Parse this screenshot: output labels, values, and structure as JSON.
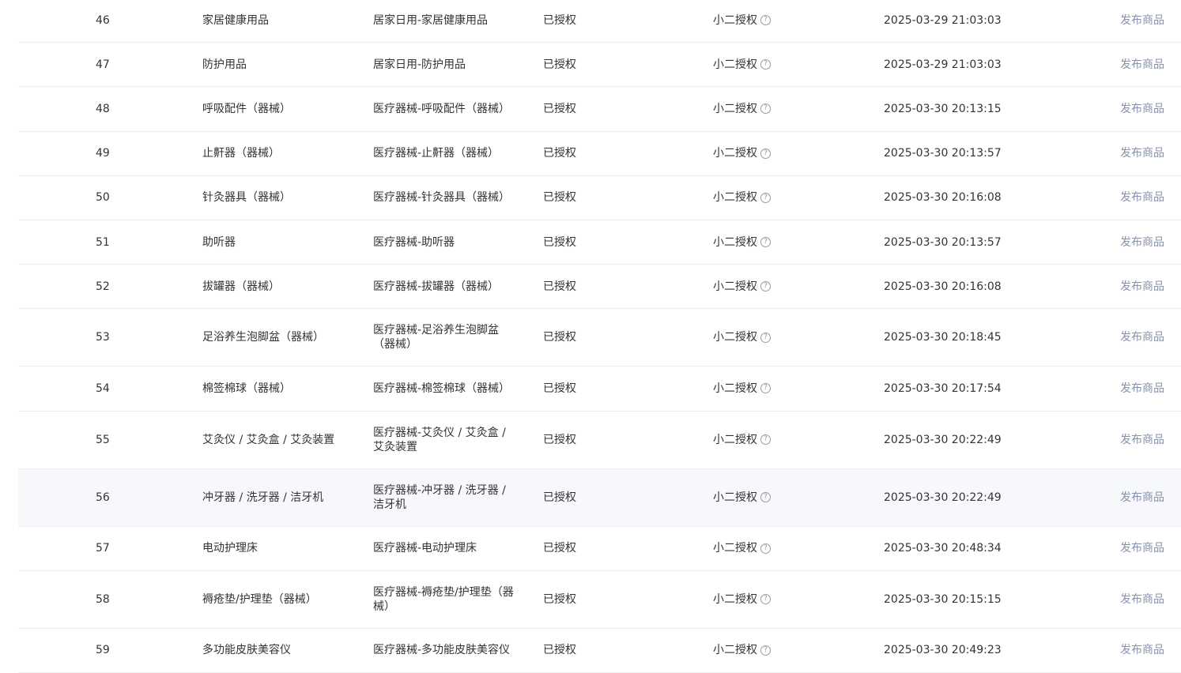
{
  "rows": [
    {
      "index": "46",
      "name": "家居健康用品",
      "path": "居家日用-家居健康用品",
      "status": "已授权",
      "auth": "小二授权",
      "time": "2025-03-29 21:03:03",
      "action": "发布商品",
      "highlight": false,
      "tall": false
    },
    {
      "index": "47",
      "name": "防护用品",
      "path": "居家日用-防护用品",
      "status": "已授权",
      "auth": "小二授权",
      "time": "2025-03-29 21:03:03",
      "action": "发布商品",
      "highlight": false,
      "tall": false
    },
    {
      "index": "48",
      "name": "呼吸配件（器械）",
      "path": "医疗器械-呼吸配件（器械）",
      "status": "已授权",
      "auth": "小二授权",
      "time": "2025-03-30 20:13:15",
      "action": "发布商品",
      "highlight": false,
      "tall": false
    },
    {
      "index": "49",
      "name": "止鼾器（器械）",
      "path": "医疗器械-止鼾器（器械）",
      "status": "已授权",
      "auth": "小二授权",
      "time": "2025-03-30 20:13:57",
      "action": "发布商品",
      "highlight": false,
      "tall": false
    },
    {
      "index": "50",
      "name": "针灸器具（器械）",
      "path": "医疗器械-针灸器具（器械）",
      "status": "已授权",
      "auth": "小二授权",
      "time": "2025-03-30 20:16:08",
      "action": "发布商品",
      "highlight": false,
      "tall": false
    },
    {
      "index": "51",
      "name": "助听器",
      "path": "医疗器械-助听器",
      "status": "已授权",
      "auth": "小二授权",
      "time": "2025-03-30 20:13:57",
      "action": "发布商品",
      "highlight": false,
      "tall": false
    },
    {
      "index": "52",
      "name": "拔罐器（器械）",
      "path": "医疗器械-拔罐器（器械）",
      "status": "已授权",
      "auth": "小二授权",
      "time": "2025-03-30 20:16:08",
      "action": "发布商品",
      "highlight": false,
      "tall": false
    },
    {
      "index": "53",
      "name": "足浴养生泡脚盆（器械）",
      "path": "医疗器械-足浴养生泡脚盆（器械）",
      "status": "已授权",
      "auth": "小二授权",
      "time": "2025-03-30 20:18:45",
      "action": "发布商品",
      "highlight": false,
      "tall": true
    },
    {
      "index": "54",
      "name": "棉签棉球（器械）",
      "path": "医疗器械-棉签棉球（器械）",
      "status": "已授权",
      "auth": "小二授权",
      "time": "2025-03-30 20:17:54",
      "action": "发布商品",
      "highlight": false,
      "tall": false
    },
    {
      "index": "55",
      "name": "艾灸仪 / 艾灸盒 / 艾灸装置",
      "path": "医疗器械-艾灸仪 / 艾灸盒 / 艾灸装置",
      "status": "已授权",
      "auth": "小二授权",
      "time": "2025-03-30 20:22:49",
      "action": "发布商品",
      "highlight": false,
      "tall": true
    },
    {
      "index": "56",
      "name": "冲牙器 / 洗牙器 / 洁牙机",
      "path": "医疗器械-冲牙器 / 洗牙器 / 洁牙机",
      "status": "已授权",
      "auth": "小二授权",
      "time": "2025-03-30 20:22:49",
      "action": "发布商品",
      "highlight": true,
      "tall": true
    },
    {
      "index": "57",
      "name": "电动护理床",
      "path": "医疗器械-电动护理床",
      "status": "已授权",
      "auth": "小二授权",
      "time": "2025-03-30 20:48:34",
      "action": "发布商品",
      "highlight": false,
      "tall": false
    },
    {
      "index": "58",
      "name": "褥疮垫/护理垫（器械）",
      "path": "医疗器械-褥疮垫/护理垫（器械）",
      "status": "已授权",
      "auth": "小二授权",
      "time": "2025-03-30 20:15:15",
      "action": "发布商品",
      "highlight": false,
      "tall": true
    },
    {
      "index": "59",
      "name": "多功能皮肤美容仪",
      "path": "医疗器械-多功能皮肤美容仪",
      "status": "已授权",
      "auth": "小二授权",
      "time": "2025-03-30 20:49:23",
      "action": "发布商品",
      "highlight": false,
      "tall": false
    }
  ],
  "icons": {
    "auth_help": "question-circle-icon",
    "auth_help_glyph": "?"
  },
  "colors": {
    "action_link": "#8792ab",
    "row_highlight": "#f6f8fc",
    "divider": "#eeeeee"
  }
}
